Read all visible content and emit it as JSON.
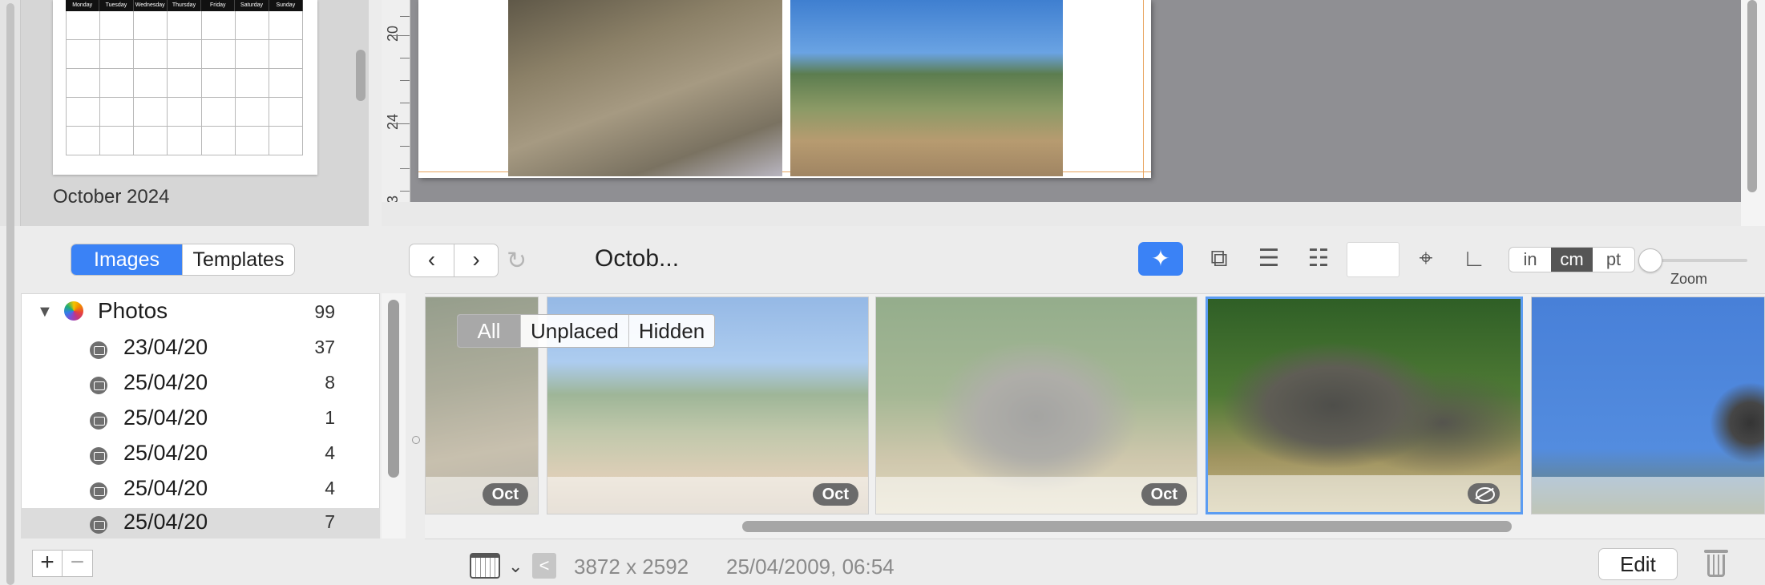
{
  "templates_panel": {
    "thumbnail_title": "October 2024",
    "weekday_headers": [
      "Monday",
      "Tuesday",
      "Wednesday",
      "Thursday",
      "Friday",
      "Saturday",
      "Sunday"
    ]
  },
  "ruler": {
    "marks": [
      "20",
      "24",
      "3"
    ]
  },
  "toolbar": {
    "images_label": "Images",
    "templates_label": "Templates",
    "doc_title": "Octob...",
    "units": [
      "in",
      "cm",
      "pt"
    ],
    "selected_unit": "cm",
    "zoom_label": "Zoom"
  },
  "sidebar": {
    "source": {
      "name": "Photos",
      "count": "99"
    },
    "albums": [
      {
        "label": "23/04/20",
        "count": "37"
      },
      {
        "label": "25/04/20",
        "count": "8"
      },
      {
        "label": "25/04/20",
        "count": "1"
      },
      {
        "label": "25/04/20",
        "count": "4"
      },
      {
        "label": "25/04/20",
        "count": "4"
      },
      {
        "label": "25/04/20",
        "count": "7"
      }
    ],
    "add_label": "+",
    "remove_label": "−"
  },
  "strip": {
    "filters": [
      "All",
      "Unplaced",
      "Hidden"
    ],
    "selected_filter": "All",
    "badges": [
      "Oct",
      "Oct",
      "Oct"
    ]
  },
  "status": {
    "dimensions": "3872 x 2592",
    "datetime": "25/04/2009, 06:54",
    "edit_label": "Edit"
  },
  "colors": {
    "accent": "#3a82f6",
    "guide": "#e8a35c",
    "canvas_bg": "#8f8f93"
  }
}
